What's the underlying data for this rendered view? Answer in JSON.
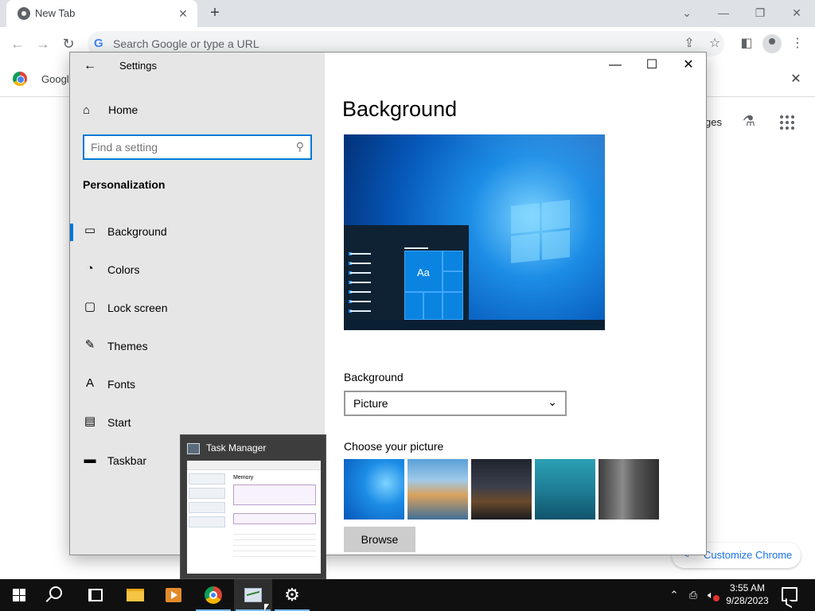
{
  "chrome": {
    "tab_title": "New Tab",
    "tab_close": "✕",
    "new_tab": "+",
    "controls": {
      "dropdown": "⌄",
      "minimize": "—",
      "restore": "❐",
      "close": "✕"
    },
    "toolbar": {
      "back": "←",
      "forward": "→",
      "reload": "↻",
      "omnibox_g": "G",
      "omnibox_placeholder": "Search Google or type a URL",
      "share": "⇪",
      "bookmark_star": "☆",
      "side_panel": "◧",
      "menu": "⋮"
    },
    "bookmark_bar": {
      "text": "Googl",
      "close": "✕"
    },
    "ntp": {
      "images_link": "ges",
      "labs_icon": "⚗",
      "customize_label": "Customize Chrome",
      "customize_icon": "✎"
    }
  },
  "settings": {
    "title": "Settings",
    "back": "←",
    "controls": {
      "minimize": "—",
      "maximize": "☐",
      "close": "✕"
    },
    "home_icon": "⌂",
    "home_label": "Home",
    "search_placeholder": "Find a setting",
    "search_icon": "⚲",
    "section": "Personalization",
    "nav_items": [
      {
        "label": "Background",
        "icon": "▭"
      },
      {
        "label": "Colors",
        "icon": "◔"
      },
      {
        "label": "Lock screen",
        "icon": "▢"
      },
      {
        "label": "Themes",
        "icon": "✎"
      },
      {
        "label": "Fonts",
        "icon": "A"
      },
      {
        "label": "Start",
        "icon": "▤"
      },
      {
        "label": "Taskbar",
        "icon": "▬"
      }
    ],
    "active_item": "Background",
    "page_title": "Background",
    "preview_tile_text": "Aa",
    "background_label": "Background",
    "background_value": "Picture",
    "background_chevron": "⌄",
    "choose_label": "Choose your picture",
    "browse_label": "Browse"
  },
  "task_manager_preview": {
    "title": "Task Manager",
    "memory_label": "Memory"
  },
  "taskbar": {
    "tray": {
      "chevron": "⌃",
      "network": "⎙",
      "volume": "🔈︎"
    },
    "time": "3:55 AM",
    "date": "9/28/2023"
  },
  "colors": {
    "accent": "#0078d7",
    "taskbar": "#101010",
    "settings_sidebar": "#e6e6e6",
    "chrome_tabstrip": "#dee1e6"
  }
}
